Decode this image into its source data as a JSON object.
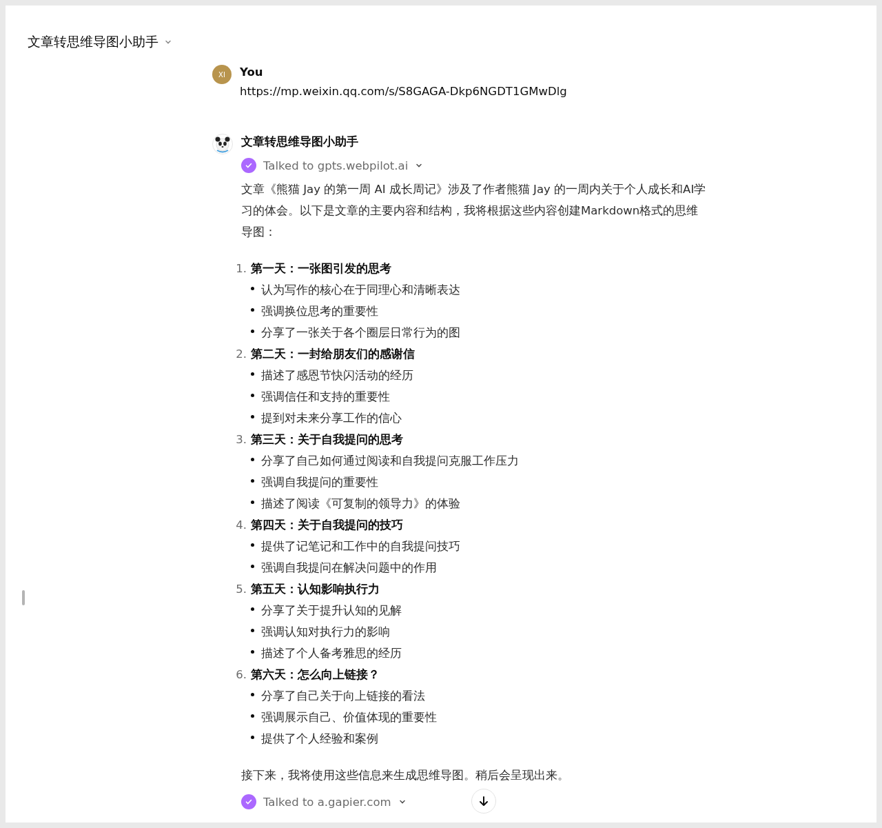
{
  "header": {
    "title": "文章转思维导图小助手"
  },
  "user_message": {
    "avatar": "XI",
    "author": "You",
    "text": "https://mp.weixin.qq.com/s/S8GAGA-Dkp6NGDT1GMwDlg"
  },
  "assistant_message": {
    "author": "文章转思维导图小助手",
    "tool_call": {
      "label": "Talked to gpts.webpilot.ai",
      "done": true
    },
    "intro": "文章《熊猫 Jay 的第一周 AI 成长周记》涉及了作者熊猫 Jay 的一周内关于个人成长和AI学习的体会。以下是文章的主要内容和结构，我将根据这些内容创建Markdown格式的思维导图：",
    "sections": [
      {
        "number": "1.",
        "title": "第一天：一张图引发的思考",
        "bullets": [
          "认为写作的核心在于同理心和清晰表达",
          "强调换位思考的重要性",
          "分享了一张关于各个圈层日常行为的图"
        ]
      },
      {
        "number": "2.",
        "title": "第二天：一封给朋友们的感谢信",
        "bullets": [
          "描述了感恩节快闪活动的经历",
          "强调信任和支持的重要性",
          "提到对未来分享工作的信心"
        ]
      },
      {
        "number": "3.",
        "title": "第三天：关于自我提问的思考",
        "bullets": [
          "分享了自己如何通过阅读和自我提问克服工作压力",
          "强调自我提问的重要性",
          "描述了阅读《可复制的领导力》的体验"
        ]
      },
      {
        "number": "4.",
        "title": "第四天：关于自我提问的技巧",
        "bullets": [
          "提供了记笔记和工作中的自我提问技巧",
          "强调自我提问在解决问题中的作用"
        ]
      },
      {
        "number": "5.",
        "title": "第五天：认知影响执行力",
        "bullets": [
          "分享了关于提升认知的见解",
          "强调认知对执行力的影响",
          "描述了个人备考雅思的经历"
        ]
      },
      {
        "number": "6.",
        "title": "第六天：怎么向上链接？",
        "bullets": [
          "分享了自己关于向上链接的看法",
          "强调展示自己、价值体现的重要性",
          "提供了个人经验和案例"
        ]
      }
    ],
    "outro": "接下来，我将使用这些信息来生成思维导图。稍后会呈现出来。",
    "tool_call_2": {
      "label": "Talked to a.gapier.com",
      "done": true
    }
  }
}
